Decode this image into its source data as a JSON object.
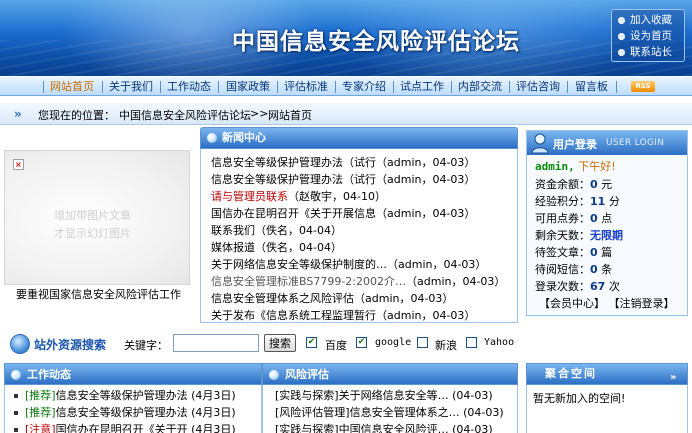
{
  "site": {
    "title": "中国信息安全风险评估论坛"
  },
  "quick_links": [
    "加入收藏",
    "设为首页",
    "联系站长"
  ],
  "nav": {
    "items": [
      "网站首页",
      "关于我们",
      "工作动态",
      "国家政策",
      "评估标准",
      "专家介绍",
      "试点工作",
      "内部交流",
      "评估咨询",
      "留言板"
    ],
    "active": "网站首页",
    "rss_label": "RSS"
  },
  "breadcrumb": {
    "label": "您现在的位置：",
    "site": "中国信息安全风险评估论坛",
    "sep": ">>",
    "current": "网站首页"
  },
  "slideshow": {
    "placeholder_line1": "增加带图片文章",
    "placeholder_line2": "才显示幻灯图片",
    "caption": "要重视国家信息安全风险评估工作"
  },
  "news": {
    "title": "新闻中心",
    "items": [
      {
        "title": "信息安全等级保护管理办法（试行",
        "meta": "（admin，04-03）"
      },
      {
        "title": "信息安全等级保护管理办法（试行",
        "meta": "（admin，04-03）"
      },
      {
        "title": "请与管理员联系",
        "meta": "（赵敬宇，04-10）",
        "style": "red"
      },
      {
        "title": "国信办在昆明召开《关于开展信息",
        "meta": "（admin，04-03）"
      },
      {
        "title": "联系我们",
        "meta": "（佚名，04-04）"
      },
      {
        "title": "媒体报道",
        "meta": "（佚名，04-04）"
      },
      {
        "title": "关于网络信息安全等级保护制度的…",
        "meta": "（admin，04-03）"
      },
      {
        "title": "信息安全管理标准BS7799-2:2002介…",
        "meta": "（admin，04-03）",
        "style": "gray"
      },
      {
        "title": "信息安全管理体系之风险评估",
        "meta": "（admin，04-03）"
      },
      {
        "title": "关于发布《信息系统工程监理暂行",
        "meta": "（admin，04-03）"
      }
    ]
  },
  "login": {
    "title": "用户登录",
    "subtitle": "USER LOGIN",
    "user": "admin,",
    "greeting": "下午好!",
    "rows": [
      {
        "label": "资金余额：",
        "value": "0",
        "unit": "元"
      },
      {
        "label": "经验积分：",
        "value": "11",
        "unit": "分"
      },
      {
        "label": "可用点券：",
        "value": "0",
        "unit": "点"
      },
      {
        "label": "剩余天数：",
        "value": "无限期",
        "unit": ""
      },
      {
        "label": "待签文章：",
        "value": "0",
        "unit": "篇"
      },
      {
        "label": "待阅短信：",
        "value": "0",
        "unit": "条"
      },
      {
        "label": "登录次数：",
        "value": "67",
        "unit": "次"
      }
    ],
    "member_center": "【会员中心】",
    "logout": "【注销登录】"
  },
  "search": {
    "logo_text": "站外资源搜索",
    "keyword_label": "关键字：",
    "keyword_value": "",
    "button": "搜索",
    "engines": [
      {
        "name": "百度",
        "checked": true
      },
      {
        "name": "google",
        "checked": true
      },
      {
        "name": "新浪",
        "checked": false
      },
      {
        "name": "Yahoo",
        "checked": false
      }
    ]
  },
  "work": {
    "title": "工作动态",
    "items": [
      {
        "tag": "[推荐]",
        "text": "信息安全等级保护管理办法",
        "date": "(4月3日)"
      },
      {
        "tag": "[推荐]",
        "text": "信息安全等级保护管理办法",
        "date": "(4月3日)"
      },
      {
        "tag": "[注意]",
        "text": "国信办在昆明召开《关于开",
        "date": "(4月3日)"
      }
    ]
  },
  "risk": {
    "title": "风险评估",
    "items": [
      {
        "text": "[实践与探索]关于网络信息安全等…",
        "date": "(04-03)"
      },
      {
        "text": "[风险评估管理]信息安全管理体系之…",
        "date": "(04-03)"
      },
      {
        "text": "[实践与探索]中国信息安全风险评…",
        "date": "(04-03)"
      }
    ]
  },
  "share": {
    "title": "聚合空间",
    "text": "暂无新加入的空间!"
  }
}
